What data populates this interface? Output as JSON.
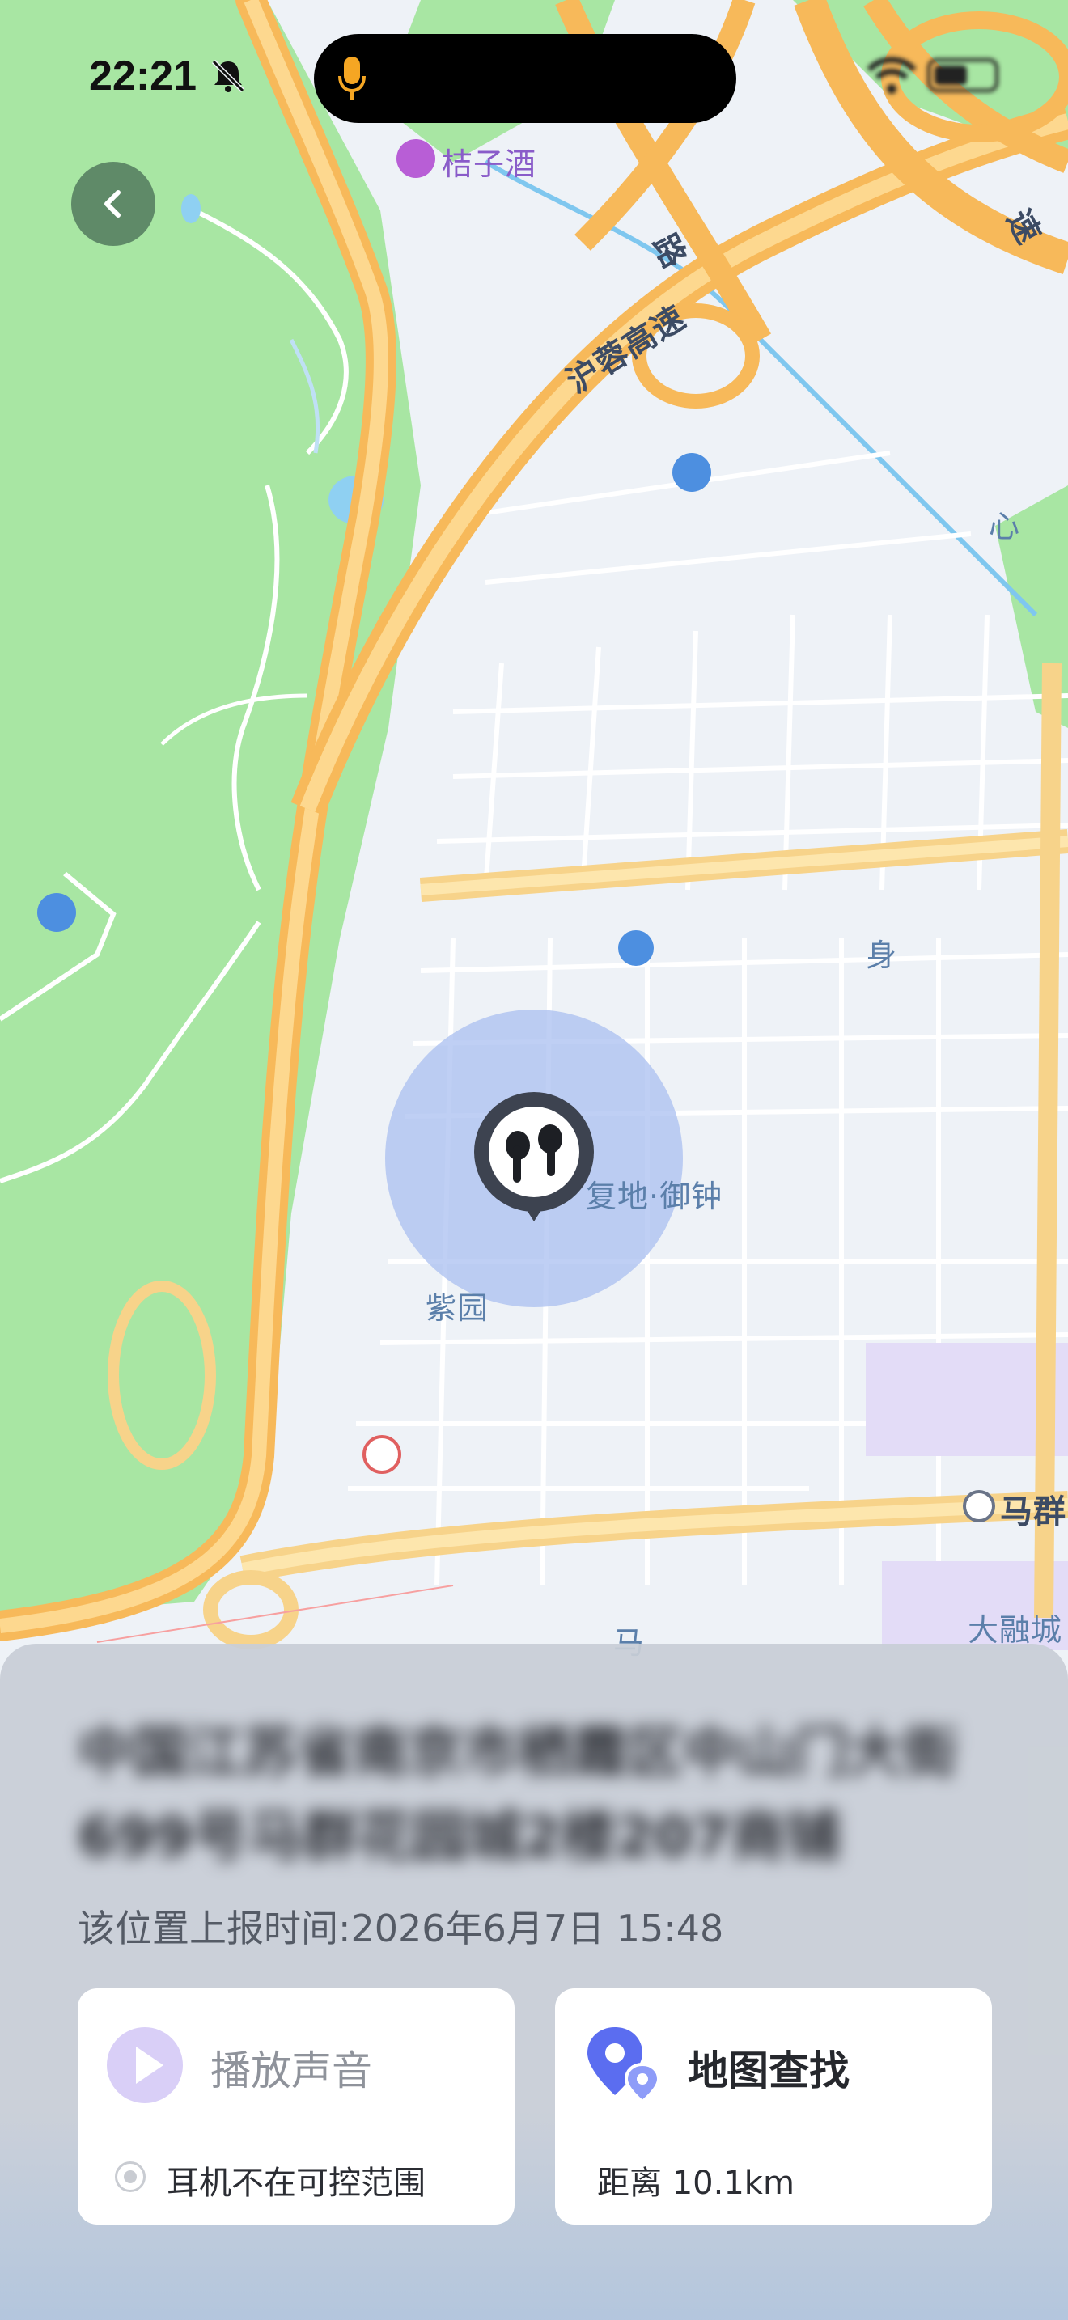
{
  "status_bar": {
    "time": "22:21",
    "icons": [
      "bell-off-icon",
      "mic-icon",
      "wifi-icon",
      "battery-icon"
    ]
  },
  "back_button": {
    "icon": "chevron-left-icon"
  },
  "map": {
    "labels": {
      "hotel": "桔子酒",
      "road_1": "沪蓉高速",
      "road_2": "路",
      "area_1": "紫园",
      "poi_1": "复地·御钟",
      "poi_2": "马群",
      "poi_3": "大融城",
      "poi_4": "马",
      "poi_5": "身",
      "poi_6": "速",
      "poi_7": "心"
    },
    "colors": {
      "park": "#a8e6a3",
      "highway": "#f7b95a",
      "road": "#ffffff",
      "urban": "#eef2f7",
      "accuracy_circle": "#a9bff0"
    },
    "device_marker_icon": "earbuds-icon"
  },
  "sheet": {
    "address": "中国江苏省南京市栖霞区中山门大街699号马群花园城2楼207商铺",
    "report_time": "该位置上报时间:2026年6月7日 15:48",
    "play_sound": {
      "label": "播放声音",
      "status": "耳机不在可控范围",
      "icon": "play-icon"
    },
    "map_find": {
      "label": "地图查找",
      "distance": "距离 10.1km",
      "icon": "map-pin-icon"
    }
  }
}
